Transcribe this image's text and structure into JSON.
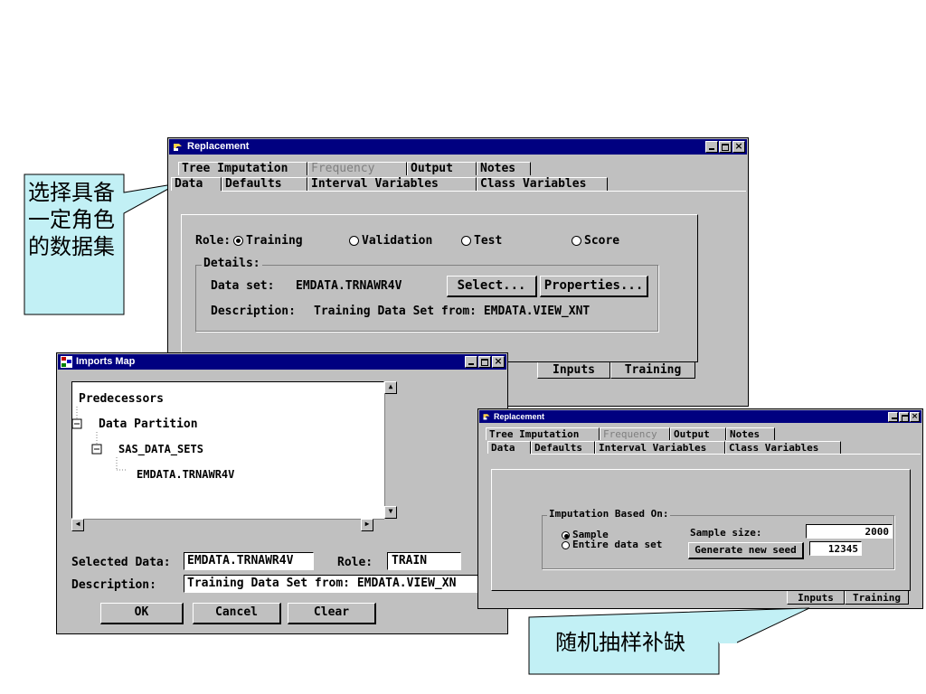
{
  "replacement_large": {
    "title": "Replacement",
    "tabs_row1": [
      "Tree Imputation",
      "Frequency",
      "Output",
      "Notes"
    ],
    "tabs_row2": [
      "Data",
      "Defaults",
      "Interval Variables",
      "Class Variables"
    ],
    "role_label": "Role:",
    "roles": [
      "Training",
      "Validation",
      "Test",
      "Score"
    ],
    "details_label": "Details:",
    "dataset_label": "Data set:",
    "dataset_value": "EMDATA.TRNAWR4V",
    "select_button": "Select...",
    "properties_button": "Properties...",
    "description_label": "Description:",
    "description_value": "Training Data Set from: EMDATA.VIEW_XNT",
    "bottom_tabs": [
      "Inputs",
      "Training"
    ]
  },
  "imports_map": {
    "title": "Imports Map",
    "tree": [
      "Predecessors",
      "Data Partition",
      "SAS_DATA_SETS",
      "EMDATA.TRNAWR4V"
    ],
    "selected_data_label": "Selected Data:",
    "selected_data_value": "EMDATA.TRNAWR4V",
    "role_label": "Role:",
    "role_value": "TRAIN",
    "description_label": "Description:",
    "description_value": "Training Data Set from: EMDATA.VIEW_XN",
    "ok_button": "OK",
    "cancel_button": "Cancel",
    "clear_button": "Clear"
  },
  "replacement_small": {
    "title": "Replacement",
    "tabs_row1": [
      "Tree Imputation",
      "Frequency",
      "Output",
      "Notes"
    ],
    "tabs_row2": [
      "Data",
      "Defaults",
      "Interval Variables",
      "Class Variables"
    ],
    "group_label": "Imputation Based On:",
    "options": [
      "Sample",
      "Entire data set"
    ],
    "sample_size_label": "Sample size:",
    "sample_size_value": "2000",
    "seed_button": "Generate new seed",
    "seed_value": "12345",
    "bottom_tabs": [
      "Inputs",
      "Training"
    ]
  },
  "callouts": {
    "left_text": "选择具备一定角色的数据集",
    "bottom_text": "随机抽样补缺"
  }
}
